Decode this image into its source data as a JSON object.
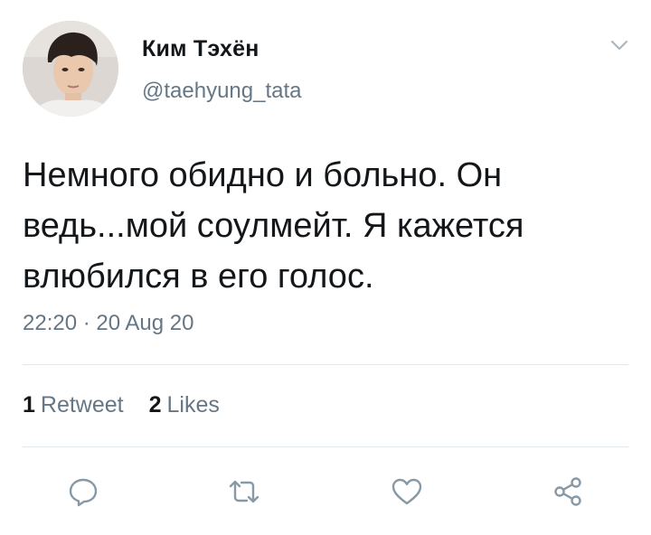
{
  "author": {
    "name": "Ким Тэхён",
    "handle": "@taehyung_tata",
    "avatar": "profile-photo"
  },
  "tweet": {
    "text": "Немного обидно и больно. Он\nведь...мой соулмейт. Я кажется\nвлюбился в его голос.",
    "timestamp": "22:20 · 20 Aug 20"
  },
  "stats": {
    "retweets_count": "1",
    "retweets_label": "Retweet",
    "likes_count": "2",
    "likes_label": "Likes"
  },
  "actions": [
    {
      "icon": "reply-icon"
    },
    {
      "icon": "retweet-icon"
    },
    {
      "icon": "like-icon"
    },
    {
      "icon": "share-icon"
    }
  ],
  "colors": {
    "primary_text": "#14171a",
    "secondary_text": "#657786",
    "divider": "#e1e8ed",
    "icon": "#8899a6"
  }
}
